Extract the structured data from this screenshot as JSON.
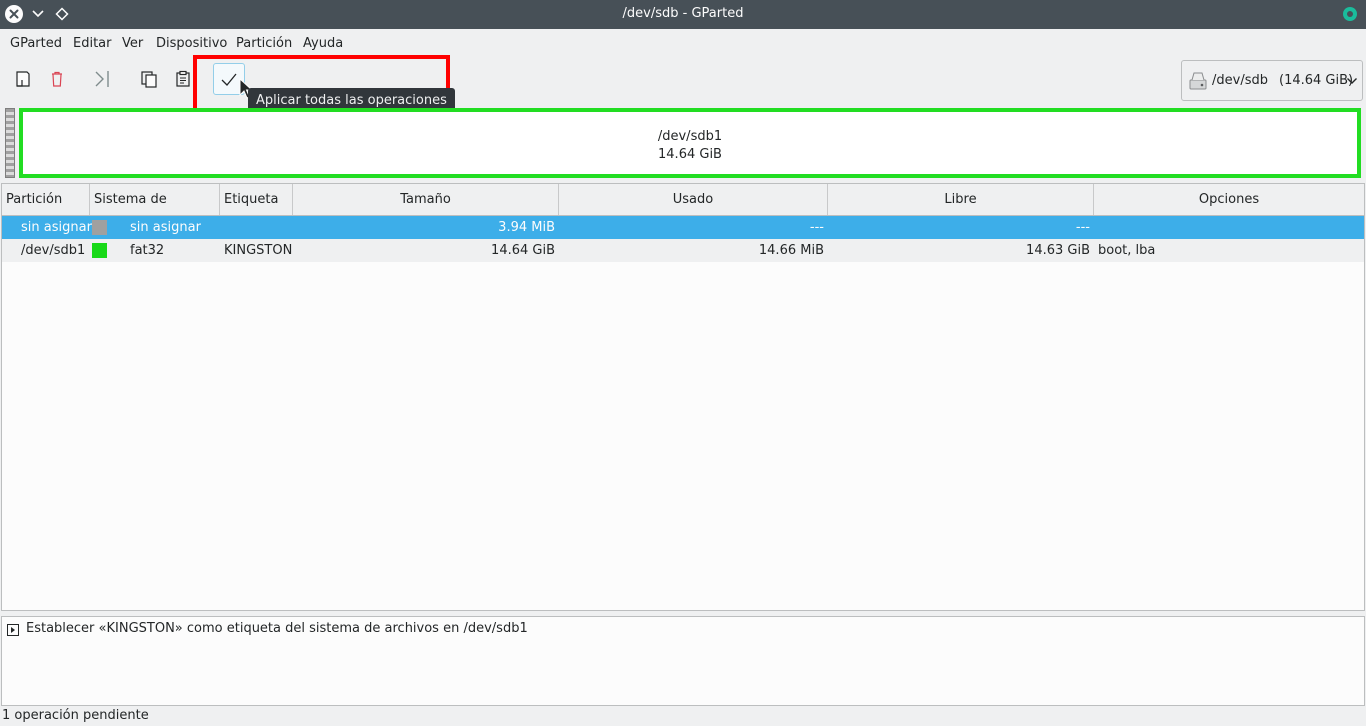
{
  "window": {
    "title": "/dev/sdb - GParted"
  },
  "menu": [
    "GParted",
    "Editar",
    "Ver",
    "Dispositivo",
    "Partición",
    "Ayuda"
  ],
  "toolbar": {
    "tooltip": "Aplicar todas las operaciones"
  },
  "device": {
    "name": "/dev/sdb",
    "size": "(14.64 GiB)"
  },
  "partition_bar": {
    "name": "/dev/sdb1",
    "size": "14.64 GiB"
  },
  "table": {
    "columns": [
      "Partición",
      "Sistema de archivos",
      "Etiqueta",
      "Tamaño",
      "Usado",
      "Libre",
      "Opciones"
    ],
    "rows": [
      {
        "partition": "sin asignar",
        "fs": "sin asignar",
        "label": "",
        "size": "3.94 MiB",
        "used": "---",
        "free": "---",
        "flags": "",
        "color": "#a0a0a0"
      },
      {
        "partition": "/dev/sdb1",
        "fs": "fat32",
        "label": "KINGSTON",
        "size": "14.64 GiB",
        "used": "14.66 MiB",
        "free": "14.63 GiB",
        "flags": "boot, lba",
        "color": "#18d918"
      }
    ]
  },
  "operations_log": {
    "entry": "Establecer «KINGSTON» como etiqueta del sistema de archivos en /dev/sdb1"
  },
  "status": {
    "text": "1 operación pendiente"
  },
  "colors": {
    "selection": "#3daee9",
    "highlight_box": "#ff0000",
    "partition_border": "#22dd22"
  }
}
